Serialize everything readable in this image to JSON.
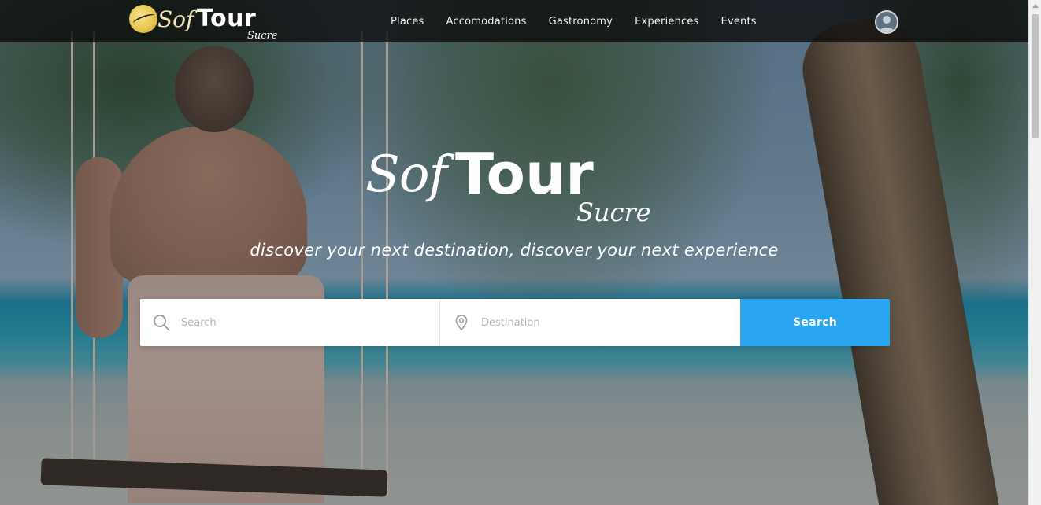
{
  "brand": {
    "sof": "Sof",
    "tour": "Tour",
    "sub": "Sucre"
  },
  "nav": {
    "items": [
      {
        "label": "Places"
      },
      {
        "label": "Accomodations"
      },
      {
        "label": "Gastronomy"
      },
      {
        "label": "Experiences"
      },
      {
        "label": "Events"
      }
    ]
  },
  "hero": {
    "logo_sof": "Sof",
    "logo_tour": "Tour",
    "logo_sub": "Sucre",
    "tagline": "discover your next destination, discover your next experience"
  },
  "search": {
    "query_placeholder": "Search",
    "query_value": "",
    "destination_placeholder": "Destination",
    "destination_value": "",
    "button_label": "Search"
  },
  "icons": {
    "search": "search-icon",
    "destination": "map-pin-icon",
    "avatar": "user-avatar-icon"
  },
  "colors": {
    "accent": "#2aa6f0",
    "navbar_bg": "#0c0c0c",
    "logo_gold": "#e6c44b"
  }
}
